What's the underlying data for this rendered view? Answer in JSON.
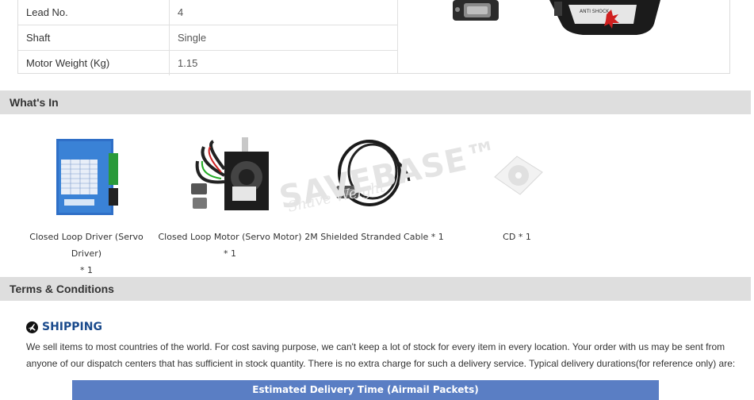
{
  "specs": [
    {
      "label": "Lead No.",
      "value": "4"
    },
    {
      "label": "Shaft",
      "value": "Single"
    },
    {
      "label": "Motor Weight (Kg)",
      "value": "1.15"
    }
  ],
  "sections": {
    "whats_in": "What's In",
    "terms": "Terms & Conditions"
  },
  "items": [
    {
      "line1": "Closed Loop Driver (Servo Driver)",
      "line2": "* 1"
    },
    {
      "line1": "Closed Loop Motor (Servo Motor)",
      "line2": "* 1"
    },
    {
      "line1": "2M Shielded Stranded Cable * 1",
      "line2": ""
    },
    {
      "line1": "CD * 1",
      "line2": ""
    }
  ],
  "watermark": {
    "brand": "SAVEBASE™",
    "tagline": "Shave Weight"
  },
  "shipping": {
    "title": "SHIPPING",
    "text": "We sell items to most countries of the world. For cost saving purpose, we can't keep a lot of stock for every item in every location. Your order with us may be sent from anyone of our dispatch centers that has sufficient in stock quantity. There is no extra charge for such a delivery service. Typical delivery durations(for reference only) are:",
    "table_header": "Estimated Delivery Time (Airmail Packets)"
  },
  "colors": {
    "section_bar": "#dedede",
    "shipping_title": "#1a4a8c",
    "table_header": "#5a7ec4"
  }
}
